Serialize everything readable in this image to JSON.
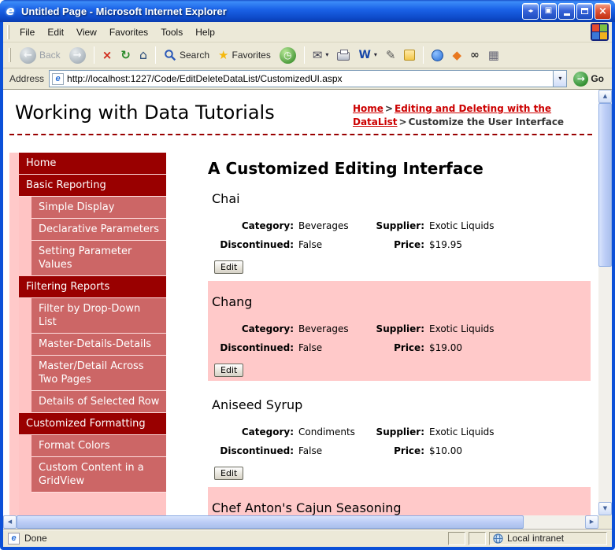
{
  "titlebar": {
    "title": "Untitled Page - Microsoft Internet Explorer"
  },
  "menubar": {
    "items": [
      "File",
      "Edit",
      "View",
      "Favorites",
      "Tools",
      "Help"
    ]
  },
  "toolbar": {
    "back_label": "Back",
    "search_label": "Search",
    "favorites_label": "Favorites"
  },
  "addressbar": {
    "label": "Address",
    "url": "http://localhost:1227/Code/EditDeleteDataList/CustomizedUI.aspx",
    "go_label": "Go"
  },
  "header": {
    "site_title": "Working with Data Tutorials",
    "separator": ">",
    "breadcrumb": [
      {
        "label": "Home",
        "link": true
      },
      {
        "label": "Editing and Deleting with the DataList",
        "link": true
      },
      {
        "label": "Customize the User Interface",
        "link": false
      }
    ]
  },
  "sidebar": {
    "items": [
      {
        "label": "Home",
        "type": "header"
      },
      {
        "label": "Basic Reporting",
        "type": "header"
      },
      {
        "label": "Simple Display",
        "type": "item"
      },
      {
        "label": "Declarative Parameters",
        "type": "item"
      },
      {
        "label": "Setting Parameter Values",
        "type": "item"
      },
      {
        "label": "Filtering Reports",
        "type": "header"
      },
      {
        "label": "Filter by Drop-Down List",
        "type": "item"
      },
      {
        "label": "Master-Details-Details",
        "type": "item"
      },
      {
        "label": "Master/Detail Across Two Pages",
        "type": "item"
      },
      {
        "label": "Details of Selected Row",
        "type": "item"
      },
      {
        "label": "Customized Formatting",
        "type": "header"
      },
      {
        "label": "Format Colors",
        "type": "item"
      },
      {
        "label": "Custom Content in a GridView",
        "type": "item"
      }
    ]
  },
  "main": {
    "title": "A Customized Editing Interface",
    "field_labels": {
      "category": "Category:",
      "supplier": "Supplier:",
      "discontinued": "Discontinued:",
      "price": "Price:"
    },
    "edit_label": "Edit",
    "products": [
      {
        "name": "Chai",
        "category": "Beverages",
        "supplier": "Exotic Liquids",
        "discontinued": "False",
        "price": "$19.95",
        "highlighted": false
      },
      {
        "name": "Chang",
        "category": "Beverages",
        "supplier": "Exotic Liquids",
        "discontinued": "False",
        "price": "$19.00",
        "highlighted": true
      },
      {
        "name": "Aniseed Syrup",
        "category": "Condiments",
        "supplier": "Exotic Liquids",
        "discontinued": "False",
        "price": "$10.00",
        "highlighted": false
      },
      {
        "name": "Chef Anton's Cajun Seasoning",
        "highlighted": true,
        "partial": true
      }
    ]
  },
  "statusbar": {
    "left": "Done",
    "right": "Local intranet"
  },
  "icons": {
    "ie_logo": "e",
    "titlebar_restore": "◂▸",
    "titlebar_window": "▣",
    "close": "×",
    "back": "←",
    "forward": "→",
    "stop": "×",
    "refresh": "↻",
    "home": "⌂",
    "favorites_star": "★",
    "history": "◷",
    "mail": "✉",
    "word": "W",
    "edit": "✎",
    "dropdown": "▾",
    "starburst": "◆",
    "binoculars": "∞",
    "grid": "▦",
    "go": "→",
    "up": "▲",
    "down": "▼",
    "left": "◀",
    "right": "▶",
    "page": "e"
  },
  "colors": {
    "title_blue": "#1b63e8",
    "chrome": "#ece9d8",
    "nav_dark_red": "#990000",
    "nav_light_red": "#cc6666",
    "pink_highlight": "#ffc9c9",
    "link_red": "#cc0000"
  }
}
